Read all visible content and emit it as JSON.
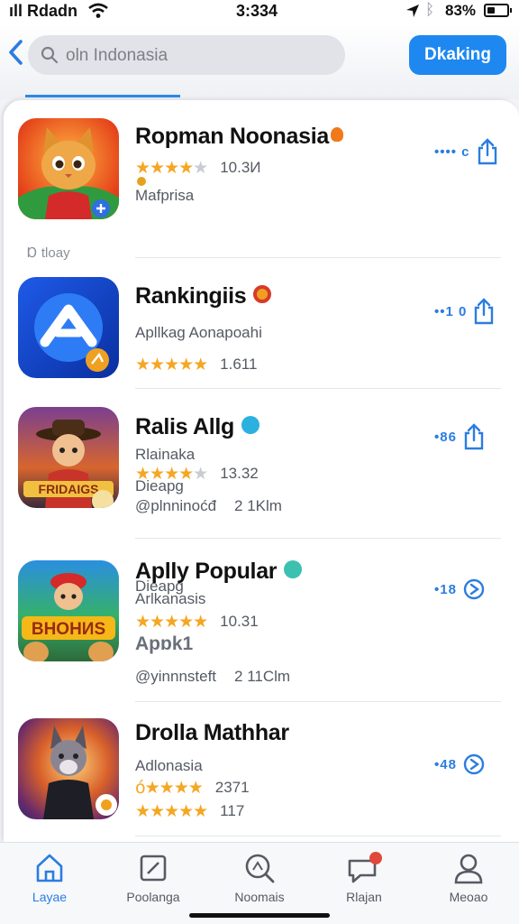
{
  "status_bar": {
    "carrier": "ıll Rdadn",
    "time": "3:334",
    "battery": "83%"
  },
  "nav": {
    "search_text": "oln Indonasia",
    "action_button": "Dkaking"
  },
  "section_label": "Ɒ tloay",
  "apps": [
    {
      "title": "Ropman Noonasia",
      "rating_count": "10.3И",
      "subtitle": "Mafprisa",
      "share_count": "•••• c"
    },
    {
      "title": "Rankingiis",
      "subtitle": "Apllkag Aonapoahi",
      "rating_count": "1.611",
      "share_count": "••1 0"
    },
    {
      "title": "Ralis Allg",
      "subtitle": "Rlainaka",
      "rating_count": "13.32",
      "extra": "Dieapg",
      "handle": "@plnninoćđ",
      "size": "2 1Klm",
      "share_count": "•86"
    },
    {
      "title": "Aplly Popular",
      "subtitle": "Arlkanasis",
      "rating_count": "10.31",
      "extra": "Apɒk1",
      "handle": "@yinnnsteft",
      "size": "2 11Clm",
      "share_count": "•18"
    },
    {
      "title": "Drolla Mathhar",
      "subtitle": "Adlonasia",
      "rating_count": "2371",
      "rating_count_2": "117",
      "share_count": "•48"
    }
  ],
  "tabs": [
    {
      "label": "Layae",
      "icon": "home-icon"
    },
    {
      "label": "Poolanga",
      "icon": "square-icon"
    },
    {
      "label": "Noomais",
      "icon": "search-icon"
    },
    {
      "label": "Rlajan",
      "icon": "chat-icon"
    },
    {
      "label": "Meoao",
      "icon": "person-icon"
    }
  ],
  "colors": {
    "accent": "#1e88f0",
    "star": "#f5a623",
    "verified": "#2bb0e0"
  }
}
